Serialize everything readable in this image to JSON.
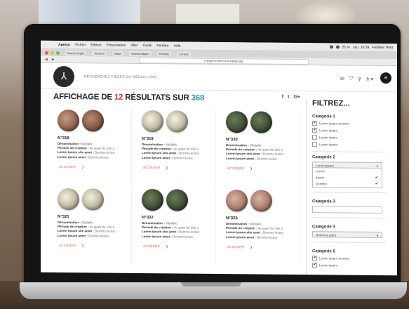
{
  "menubar": {
    "items": [
      "Aperçu",
      "Fichier",
      "Édition",
      "Présentation",
      "Aller",
      "Outils",
      "Fenêtre",
      "Aide"
    ],
    "clock": "Jeu. 16:39",
    "battery": "25 %",
    "user": "Frédéric Petit"
  },
  "browser": {
    "url": "fr-page-recherche-full-page.jpg",
    "tabs": [
      "Nouvel onglet",
      "Amazon",
      "Maps",
      "Numismatique",
      "Portfolio",
      "Contact"
    ]
  },
  "header": {
    "logo_glyph": "⅄",
    "search_placeholder": "RECHERCHEZ PIÈCES OU MÉDAILLONS...",
    "icons": [
      "mail-icon",
      "shield-icon",
      "search-icon",
      "language-icon"
    ],
    "lang": "fr ▾",
    "menu_glyph": "≡"
  },
  "main": {
    "title_prefix": "AFFICHAGE DE",
    "results_count": "12",
    "title_middle": "RÉSULTATS SUR",
    "total": "368",
    "share": {
      "facebook": "f",
      "twitter": "t",
      "google": "G+"
    },
    "labels": {
      "denomination": "Dénomination :",
      "period": "Période de création :",
      "lorem1": "Lorem ipsum site amet :",
      "lorem2": "Lorem ipsum amet :"
    },
    "access_label": "ACCÉDER",
    "cards": [
      {
        "num": "N°318",
        "denomination": "Médaille",
        "period": "4e quart du 19e s.",
        "lorem1": "Demmo lectus",
        "lorem2": "Demmo lectus",
        "coins": [
          "bronze",
          "darkbr"
        ]
      },
      {
        "num": "N°319",
        "denomination": "Médaille",
        "period": "4e quart du 19e s.",
        "lorem1": "Demmo lectus",
        "lorem2": "Demmo lectus",
        "coins": [
          "silver",
          "silver"
        ]
      },
      {
        "num": "N°320",
        "denomination": "Médaille",
        "period": "4e quart du 19e s.",
        "lorem1": "Demmo lectus",
        "lorem2": "Demmo lectus",
        "coins": [
          "green",
          "green"
        ]
      },
      {
        "num": "N°321",
        "denomination": "Médaille",
        "period": "4e quart du 19e s.",
        "lorem1": "Demmo lectus",
        "lorem2": "Demmo lectus",
        "coins": [
          "silver",
          "silver"
        ]
      },
      {
        "num": "N°322",
        "denomination": "Médaille",
        "period": "4e quart du 19e s.",
        "lorem1": "Demmo lectus",
        "lorem2": "Demmo lectus",
        "coins": [
          "green",
          "green"
        ]
      },
      {
        "num": "N°323",
        "denomination": "Médaille",
        "period": "4e quart du 19e s.",
        "lorem1": "Demmo lectus",
        "lorem2": "Demmo lectus",
        "coins": [
          "pinkbr",
          "pinkbr"
        ]
      }
    ]
  },
  "sidebar": {
    "title": "FILTREZ...",
    "cat1": {
      "label": "Categorie 1",
      "options": [
        {
          "label": "Lorem ipsum sit amet",
          "checked": true
        },
        {
          "label": "Lorem ipsum",
          "checked": true
        },
        {
          "label": "Lorem ipsum",
          "checked": false
        },
        {
          "label": "Lorem ipsum",
          "checked": false
        }
      ]
    },
    "cat2": {
      "label": "Categorie 2",
      "selected": "Lorem ipsum",
      "options": [
        {
          "label": "Lorem",
          "checked": false
        },
        {
          "label": "Ipsum",
          "checked": true
        },
        {
          "label": "Demmo",
          "checked": true
        }
      ]
    },
    "cat3": {
      "label": "Categorie 3",
      "value": ""
    },
    "cat4": {
      "label": "Categorie 4",
      "selected": "Dommus patre"
    },
    "cat5": {
      "label": "Categorie 5",
      "options": [
        {
          "label": "Lorem ipsum sit amet",
          "checked": true
        },
        {
          "label": "Lorem ipsum",
          "checked": true
        }
      ]
    }
  },
  "colors": {
    "accent_red": "#c0392b",
    "accent_blue": "#3f92c7",
    "dark": "#1a1a1a"
  }
}
